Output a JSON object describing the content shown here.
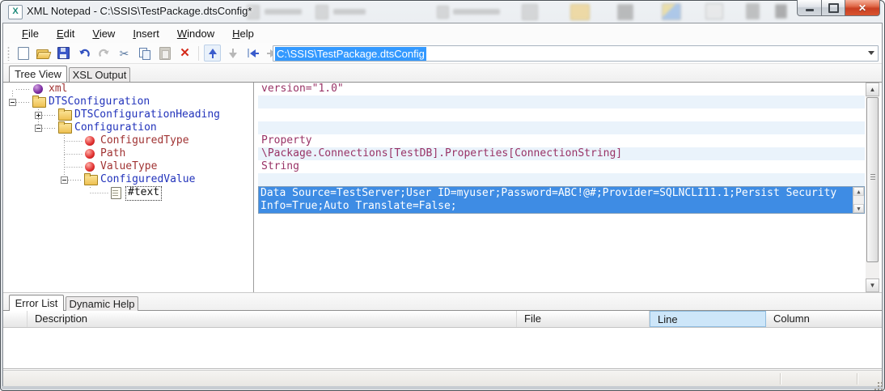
{
  "window": {
    "title": "XML Notepad - C:\\SSIS\\TestPackage.dtsConfig*"
  },
  "menu": {
    "items": [
      {
        "label": "File",
        "mnemonic": "F",
        "rest": "ile"
      },
      {
        "label": "Edit",
        "mnemonic": "E",
        "rest": "dit"
      },
      {
        "label": "View",
        "mnemonic": "V",
        "rest": "iew"
      },
      {
        "label": "Insert",
        "mnemonic": "I",
        "rest": "nsert"
      },
      {
        "label": "Window",
        "mnemonic": "W",
        "rest": "indow"
      },
      {
        "label": "Help",
        "mnemonic": "H",
        "rest": "elp"
      }
    ]
  },
  "toolbar": {
    "address_value": "C:\\SSIS\\TestPackage.dtsConfig",
    "buttons": [
      {
        "name": "new-document",
        "enabled": true
      },
      {
        "name": "open-file",
        "enabled": true
      },
      {
        "name": "save-file",
        "enabled": true
      },
      {
        "name": "undo",
        "enabled": true
      },
      {
        "name": "redo",
        "enabled": false
      },
      {
        "name": "cut",
        "enabled": true
      },
      {
        "name": "copy",
        "enabled": true
      },
      {
        "name": "paste",
        "enabled": false
      },
      {
        "name": "delete",
        "enabled": true
      },
      {
        "name": "nudge-up",
        "enabled": true
      },
      {
        "name": "nudge-down",
        "enabled": false
      },
      {
        "name": "nudge-left",
        "enabled": true
      },
      {
        "name": "nudge-right",
        "enabled": false
      }
    ]
  },
  "tabs": {
    "main": [
      {
        "label": "Tree View",
        "active": true
      },
      {
        "label": "XSL Output",
        "active": false
      }
    ],
    "bottom": [
      {
        "label": "Error List",
        "active": true
      },
      {
        "label": "Dynamic Help",
        "active": false
      }
    ]
  },
  "tree": {
    "nodes": [
      {
        "label": "xml",
        "type": "processing-instruction",
        "level": 0,
        "expanded": null
      },
      {
        "label": "DTSConfiguration",
        "type": "element",
        "level": 0,
        "expanded": true
      },
      {
        "label": "DTSConfigurationHeading",
        "type": "element",
        "level": 1,
        "expanded": false
      },
      {
        "label": "Configuration",
        "type": "element",
        "level": 1,
        "expanded": true
      },
      {
        "label": "ConfiguredType",
        "type": "attribute",
        "level": 2,
        "expanded": null
      },
      {
        "label": "Path",
        "type": "attribute",
        "level": 2,
        "expanded": null
      },
      {
        "label": "ValueType",
        "type": "attribute",
        "level": 2,
        "expanded": null
      },
      {
        "label": "ConfiguredValue",
        "type": "element",
        "level": 2,
        "expanded": true
      },
      {
        "label": "#text",
        "type": "text",
        "level": 3,
        "expanded": null,
        "focused": true
      }
    ]
  },
  "values": {
    "rows": {
      "r0": "version=\"1.0\"",
      "r4": "Property",
      "r5": "\\Package.Connections[TestDB].Properties[ConnectionString]",
      "r6": "String"
    },
    "editor": {
      "line1": "Data Source=TestServer;User ID=myuser;Password=ABC!@#;Provider=SQLNCLI11.1;Persist Security",
      "line2": "Info=True;Auto Translate=False;",
      "full_value": "Data Source=TestServer;User ID=myuser;Password=ABC!@#;Provider=SQLNCLI11.1;Persist Security Info=True;Auto Translate=False;"
    }
  },
  "error_panel": {
    "columns": [
      "Description",
      "File",
      "Line",
      "Column"
    ],
    "hover_column": "Line",
    "rows": []
  },
  "colors": {
    "selection_blue": "#3399ff",
    "editor_selection": "#3e8ce4",
    "row_stripe": "#eaf3fb",
    "element_text": "#2233bb",
    "attribute_text": "#a03333",
    "value_text": "#993366",
    "close_button": "#c93f22"
  },
  "icons": {
    "titlebar": "xml-notepad-logo",
    "window_controls": [
      "minimize",
      "maximize",
      "close"
    ],
    "address_combo": "dropdown-arrow",
    "tree": [
      "processing-instruction-sphere",
      "folder",
      "attribute-sphere",
      "text-node-doc"
    ]
  }
}
